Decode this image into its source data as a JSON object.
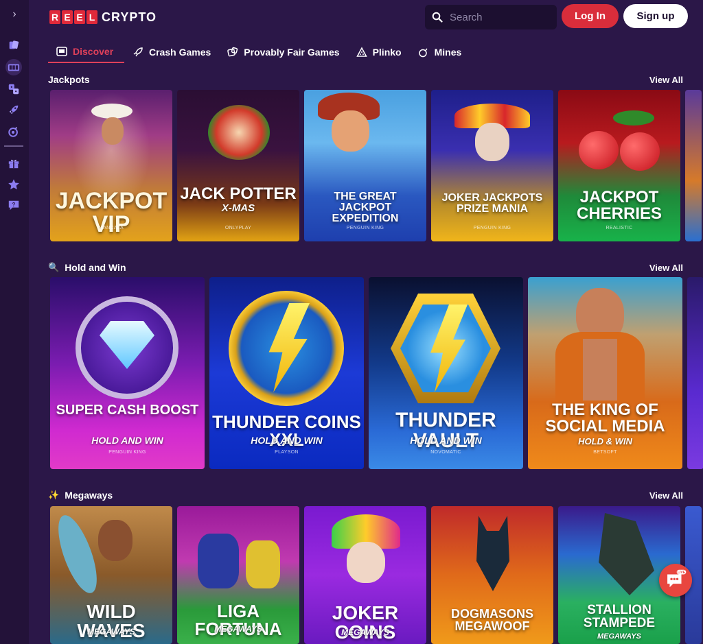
{
  "brand": {
    "reel_letters": [
      "R",
      "E",
      "E",
      "L"
    ],
    "crypto": "CRYPTO",
    "accent": "#e0293a"
  },
  "header": {
    "search_placeholder": "Search",
    "login_label": "Log In",
    "signup_label": "Sign up"
  },
  "nav": {
    "tabs": [
      {
        "label": "Discover",
        "icon": "slot-machine-icon",
        "active": true
      },
      {
        "label": "Crash Games",
        "icon": "rocket-icon"
      },
      {
        "label": "Provably Fair Games",
        "icon": "dice-icon"
      },
      {
        "label": "Plinko",
        "icon": "pyramid-icon"
      },
      {
        "label": "Mines",
        "icon": "bomb-icon"
      }
    ]
  },
  "sidebar": {
    "toggle": "›",
    "icons": [
      "cards-icon",
      "slot-machine-icon",
      "dice-icon",
      "rocket-icon",
      "bomb-icon",
      "gift-icon",
      "star-icon",
      "chat-question-icon"
    ]
  },
  "sections": {
    "jackpots": {
      "title": "Jackpots",
      "view_all": "View All",
      "games": [
        {
          "title": "JACKPOT VIP",
          "provider": "MANCALA"
        },
        {
          "title": "JACK POTTER",
          "subtitle": "X-MAS",
          "provider": "ONLYPLAY"
        },
        {
          "title": "THE GREAT JACKPOT EXPEDITION",
          "provider": "PENGUIN KING"
        },
        {
          "title": "JOKER JACKPOTS PRIZE MANIA",
          "provider": "PENGUIN KING"
        },
        {
          "title": "JACKPOT CHERRIES",
          "provider": "REALISTIC"
        }
      ]
    },
    "hold_and_win": {
      "emoji": "🔍",
      "title": "Hold and Win",
      "view_all": "View All",
      "games": [
        {
          "title": "SUPER CASH BOOST",
          "subtitle": "HOLD AND WIN",
          "provider": "PENGUIN KING"
        },
        {
          "title": "THUNDER COINS XXL",
          "subtitle": "HOLD AND WIN",
          "provider": "PLAYSON"
        },
        {
          "title": "THUNDER VAULT",
          "subtitle": "HOLD AND WIN",
          "provider": "NOVOMATIC"
        },
        {
          "title": "THE KING OF SOCIAL MEDIA",
          "subtitle": "HOLD & WIN",
          "provider": "BETSOFT"
        }
      ]
    },
    "megaways": {
      "emoji": "✨",
      "title": "Megaways",
      "view_all": "View All",
      "games": [
        {
          "title": "WILD WAVES",
          "subtitle": "MEGAWAYS"
        },
        {
          "title": "LIGA FORTUNA",
          "subtitle": "MEGAWAYS"
        },
        {
          "title": "JOKER COINS",
          "subtitle": "MEGAWAYS"
        },
        {
          "title": "DOGMASONS MEGAWOOF"
        },
        {
          "title": "STALLION STAMPEDE",
          "subtitle": "MEGAWAYS"
        }
      ]
    }
  },
  "live_chat": {
    "label": "LIVE"
  }
}
